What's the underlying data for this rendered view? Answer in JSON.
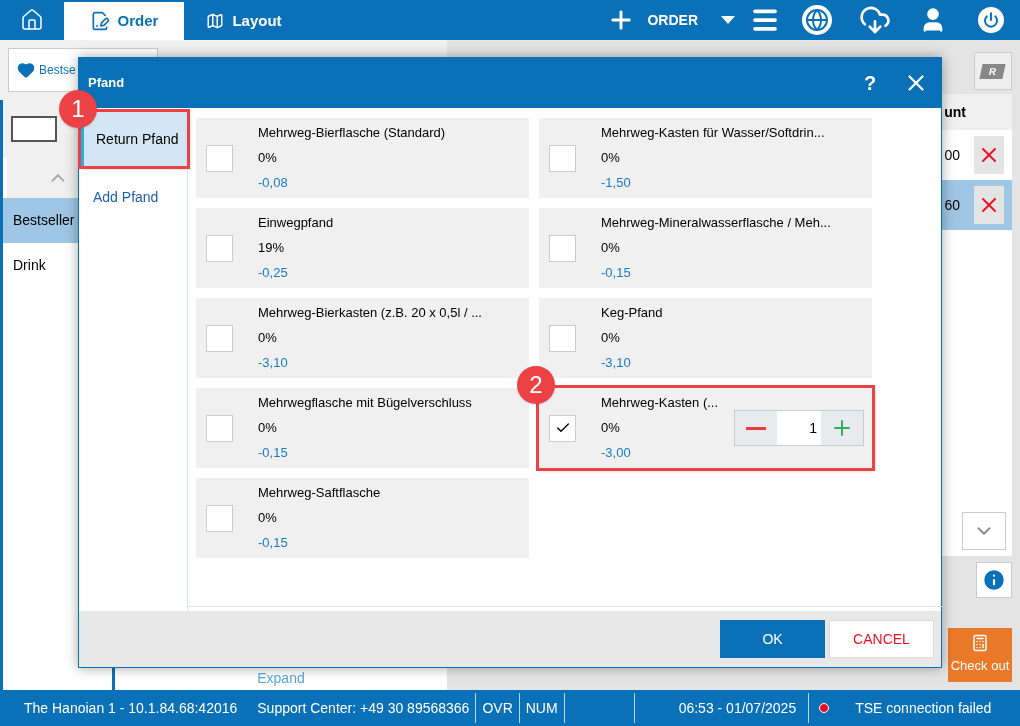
{
  "top_bar": {
    "tabs": [
      {
        "label": "Order",
        "selected": true
      },
      {
        "label": "Layout",
        "selected": false
      }
    ],
    "new_order": "ORDER"
  },
  "left_panel": {
    "favorite_button": "Bestse",
    "categories": [
      {
        "label": "Bestseller",
        "selected": true
      },
      {
        "label": "Drink",
        "selected": false
      }
    ],
    "expand": "Expand"
  },
  "order_panel": {
    "column_header": "unt",
    "rows": [
      {
        "amount": "00",
        "selected": false
      },
      {
        "amount": "60",
        "selected": true
      }
    ],
    "toolbar_button": "R",
    "checkout": "Check out"
  },
  "dialog": {
    "title": "Pfand",
    "help": "?",
    "nav": [
      {
        "label": "Return Pfand",
        "selected": true,
        "callout": "1"
      },
      {
        "label": "Add Pfand",
        "selected": false
      }
    ],
    "items": [
      {
        "name": "Mehrweg-Bierflasche (Standard)",
        "tax": "0%",
        "price": "-0,08",
        "checked": false
      },
      {
        "name": "Mehrweg-Kasten für Wasser/Softdrin...",
        "tax": "0%",
        "price": "-1,50",
        "checked": false
      },
      {
        "name": "Einwegpfand",
        "tax": "19%",
        "price": "-0,25",
        "checked": false
      },
      {
        "name": "Mehrweg-Mineralwasserflasche / Meh...",
        "tax": "0%",
        "price": "-0,15",
        "checked": false
      },
      {
        "name": "Mehrweg-Bierkasten (z.B. 20 x 0,5l / ...",
        "tax": "0%",
        "price": "-3,10",
        "checked": false
      },
      {
        "name": "Keg-Pfand",
        "tax": "0%",
        "price": "-3,10",
        "checked": false
      },
      {
        "name": "Mehrwegflasche mit Bügelverschluss",
        "tax": "0%",
        "price": "-0,15",
        "checked": false
      },
      {
        "name": "Mehrweg-Kasten (...",
        "tax": "0%",
        "price": "-3,00",
        "checked": true,
        "quantity": "1",
        "callout": "2"
      },
      {
        "name": "Mehrweg-Saftflasche",
        "tax": "0%",
        "price": "-0,15",
        "checked": false
      }
    ],
    "buttons": [
      {
        "label": "OK",
        "kind": "primary"
      },
      {
        "label": "CANCEL",
        "kind": "secondary"
      }
    ]
  },
  "status_bar": {
    "items": [
      {
        "text": "The Hanoian 1 - 10.1.84.68:42016"
      },
      {
        "text": "Support Center: +49 30 89568366"
      },
      {
        "text": "OVR"
      },
      {
        "text": "NUM"
      },
      {
        "text": "06:53 - 01/07/2025"
      },
      {
        "text": "TSE connection failed",
        "color": "#e81123"
      }
    ]
  }
}
